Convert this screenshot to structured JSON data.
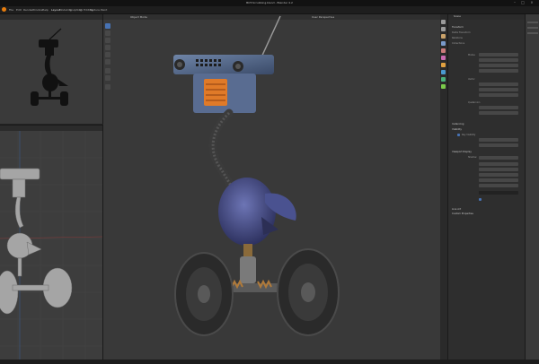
{
  "window": {
    "title": "BOT-Scrubbing.blend - Blender 4.2"
  },
  "menu": {
    "items": [
      "File",
      "Edit",
      "Render",
      "Window",
      "Help"
    ],
    "tabs": [
      "Layout",
      "Modeling",
      "Sculpting",
      "UV Editing",
      "Texture Paint",
      "Shading",
      "Animation",
      "Rendering",
      "Compositing"
    ]
  },
  "viewport": {
    "header_label": "User Perspective",
    "mode_label": "Object Mode"
  },
  "properties": {
    "tab_label": "Scene",
    "sections": {
      "transform": "Transform",
      "delta": "Delta Transform",
      "relations": "Relations",
      "collections": "Collections",
      "instancing": "Instancing",
      "visibility": "Visibility",
      "viewport_display": "Viewport Display",
      "line_art": "Line Art",
      "custom_props": "Custom Properties"
    },
    "fields": {
      "mode": "Modes",
      "vector": "Vector",
      "quat": "Quaternion",
      "ray_vis": "Ray Visibility",
      "shadow": "Shadow"
    }
  },
  "colors": {
    "accent": "#4772b3",
    "panel": "#2e2e2e",
    "viewport": "#393939"
  }
}
